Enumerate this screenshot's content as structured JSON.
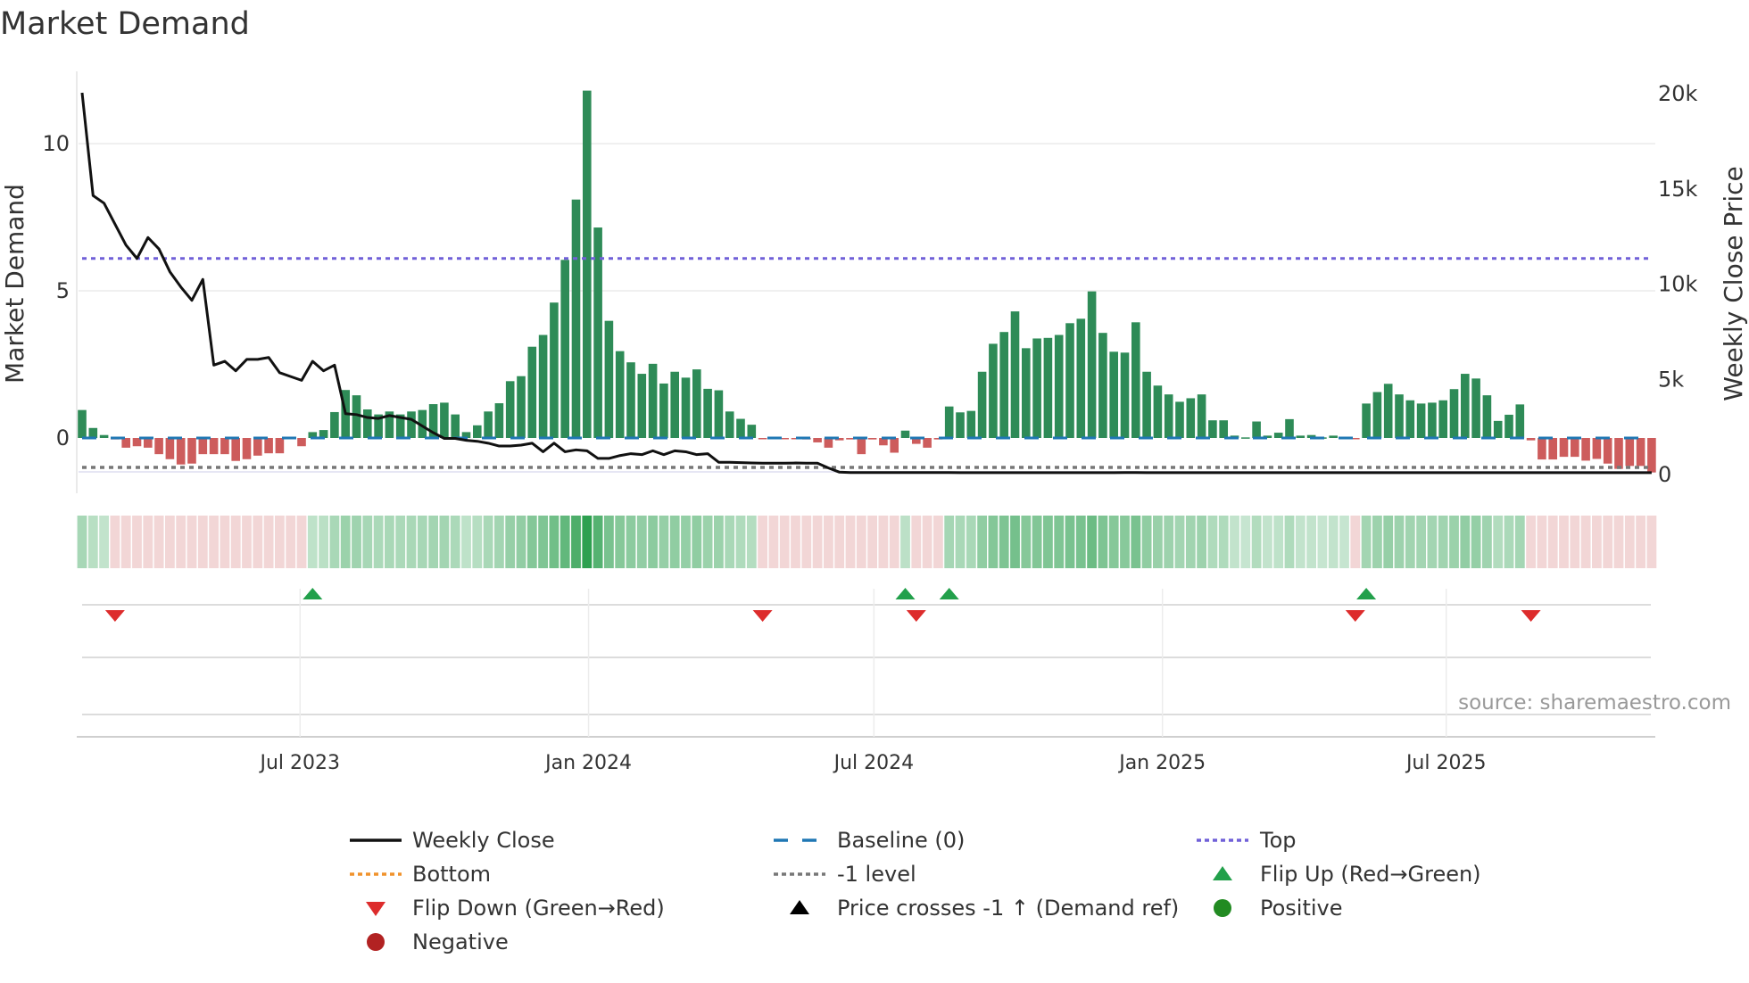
{
  "chart_data": {
    "type": "bar",
    "title": "Market Demand",
    "ylabel": "Market Demand",
    "y2label": "Weekly Close Price",
    "ylim": [
      -1.9,
      12.5
    ],
    "y2lim": [
      0,
      21000
    ],
    "yticks": [
      {
        "v": 0,
        "label": "0"
      },
      {
        "v": 5,
        "label": "5"
      },
      {
        "v": 10,
        "label": "10"
      }
    ],
    "y2ticks": [
      {
        "v": 0,
        "label": "0"
      },
      {
        "v": 5000,
        "label": "5k"
      },
      {
        "v": 10000,
        "label": "10k"
      },
      {
        "v": 15000,
        "label": "15k"
      },
      {
        "v": 20000,
        "label": "20k"
      }
    ],
    "xticks": [
      {
        "date": "2023-07-01",
        "label": "Jul 2023"
      },
      {
        "date": "2024-01-01",
        "label": "Jan 2024"
      },
      {
        "date": "2024-07-01",
        "label": "Jul 2024"
      },
      {
        "date": "2025-01-01",
        "label": "Jan 2025"
      },
      {
        "date": "2025-07-01",
        "label": "Jul 2025"
      }
    ],
    "start_date": "2023-02-12",
    "frequency": "weekly",
    "levels": {
      "baseline": 0,
      "top": 6.1,
      "minus_one": -1
    },
    "demand": [
      0.95,
      0.34,
      0.1,
      -0.05,
      -0.33,
      -0.28,
      -0.33,
      -0.55,
      -0.72,
      -0.9,
      -0.87,
      -0.55,
      -0.55,
      -0.55,
      -0.78,
      -0.72,
      -0.6,
      -0.52,
      -0.52,
      -0.02,
      -0.28,
      0.2,
      0.27,
      0.88,
      1.63,
      1.45,
      0.97,
      0.8,
      0.9,
      0.8,
      0.9,
      0.95,
      1.15,
      1.2,
      0.8,
      0.2,
      0.43,
      0.9,
      1.18,
      1.93,
      2.1,
      3.1,
      3.5,
      4.6,
      6.05,
      8.1,
      11.8,
      7.15,
      3.98,
      2.95,
      2.57,
      2.18,
      2.52,
      1.85,
      2.25,
      2.05,
      2.33,
      1.67,
      1.62,
      0.9,
      0.65,
      0.45,
      -0.02,
      -0.02,
      -0.03,
      -0.03,
      -0.05,
      -0.15,
      -0.33,
      -0.08,
      -0.05,
      -0.55,
      -0.05,
      -0.25,
      -0.5,
      0.25,
      -0.2,
      -0.33,
      -0.05,
      1.07,
      0.87,
      0.92,
      2.25,
      3.2,
      3.6,
      4.3,
      3.05,
      3.38,
      3.4,
      3.5,
      3.9,
      4.05,
      4.98,
      3.57,
      2.93,
      2.9,
      3.93,
      2.25,
      1.78,
      1.48,
      1.23,
      1.35,
      1.48,
      0.6,
      0.6,
      0.08,
      0.02,
      0.56,
      0.08,
      0.18,
      0.64,
      0.08,
      0.1,
      0.02,
      0.08,
      0.02,
      -0.03,
      1.17,
      1.56,
      1.84,
      1.48,
      1.28,
      1.17,
      1.2,
      1.28,
      1.66,
      2.18,
      2.02,
      1.45,
      0.58,
      0.79,
      1.14,
      -0.08,
      -0.73,
      -0.73,
      -0.64,
      -0.64,
      -0.77,
      -0.71,
      -0.87,
      -1.05,
      -0.95,
      -0.95,
      -1.17
    ],
    "weekly_close": [
      20000,
      14600,
      14200,
      13100,
      12000,
      11300,
      12400,
      11800,
      10600,
      9800,
      9100,
      10200,
      5700,
      5900,
      5400,
      6000,
      6000,
      6100,
      5300,
      5100,
      4900,
      5900,
      5400,
      5700,
      3150,
      3100,
      2950,
      2900,
      3050,
      2950,
      2850,
      2500,
      2150,
      1850,
      1850,
      1750,
      1700,
      1600,
      1450,
      1450,
      1500,
      1600,
      1150,
      1600,
      1150,
      1250,
      1200,
      800,
      800,
      950,
      1050,
      1000,
      1200,
      1000,
      1200,
      1150,
      1000,
      1050,
      600,
      600,
      580,
      560,
      550,
      550,
      550,
      560,
      550,
      550,
      300,
      80,
      60,
      60,
      60,
      60,
      60,
      60,
      60,
      60,
      60,
      60,
      55,
      55,
      55,
      55,
      55,
      55,
      55,
      55,
      55,
      55,
      55,
      55,
      55,
      55,
      55,
      60,
      60,
      55,
      55,
      55,
      50,
      50,
      50,
      50,
      50,
      50,
      50,
      50,
      50,
      50,
      50,
      50,
      50,
      50,
      50,
      50,
      50,
      50,
      50,
      50,
      50,
      50,
      50,
      50,
      50,
      50,
      50,
      50,
      50,
      50,
      50,
      50,
      50,
      50,
      50,
      50,
      50,
      50,
      50,
      50,
      50,
      50,
      50,
      50
    ],
    "flip_up_dates": [
      "2023-07-09",
      "2024-07-21",
      "2024-08-18",
      "2025-05-11"
    ],
    "flip_down_dates": [
      "2023-03-05",
      "2024-04-21",
      "2024-07-28",
      "2025-05-04",
      "2025-08-24"
    ],
    "legend_position": "bottom",
    "grid": true
  },
  "source": "source: sharemaestro.com",
  "legend": [
    {
      "label": "Weekly Close",
      "kind": "line-solid",
      "color": "#111111"
    },
    {
      "label": "Baseline (0)",
      "kind": "line-dash",
      "color": "#1f77b4"
    },
    {
      "label": "Top",
      "kind": "line-dot",
      "color": "#7060d8"
    },
    {
      "label": "Bottom",
      "kind": "line-dot",
      "color": "#f0922c"
    },
    {
      "label": "-1 level",
      "kind": "line-dot",
      "color": "#777777"
    },
    {
      "label": "Flip Up (Red→Green)",
      "kind": "tri-up",
      "color": "#22a04b"
    },
    {
      "label": "Flip Down (Green→Red)",
      "kind": "tri-down",
      "color": "#dd2c2c"
    },
    {
      "label": "Price crosses -1 ↑ (Demand ref)",
      "kind": "tri-up",
      "color": "#000000"
    },
    {
      "label": "Positive",
      "kind": "dot",
      "color": "#228b22"
    },
    {
      "label": "Negative",
      "kind": "dot",
      "color": "#b22222"
    }
  ],
  "colors": {
    "pos": "#2e8b57",
    "neg": "#cd5c5c",
    "baseline": "#1f77b4",
    "top": "#7060d8",
    "minus_one": "#777777",
    "price": "#111111",
    "flip_up": "#22a04b",
    "flip_down": "#dd2c2c"
  }
}
